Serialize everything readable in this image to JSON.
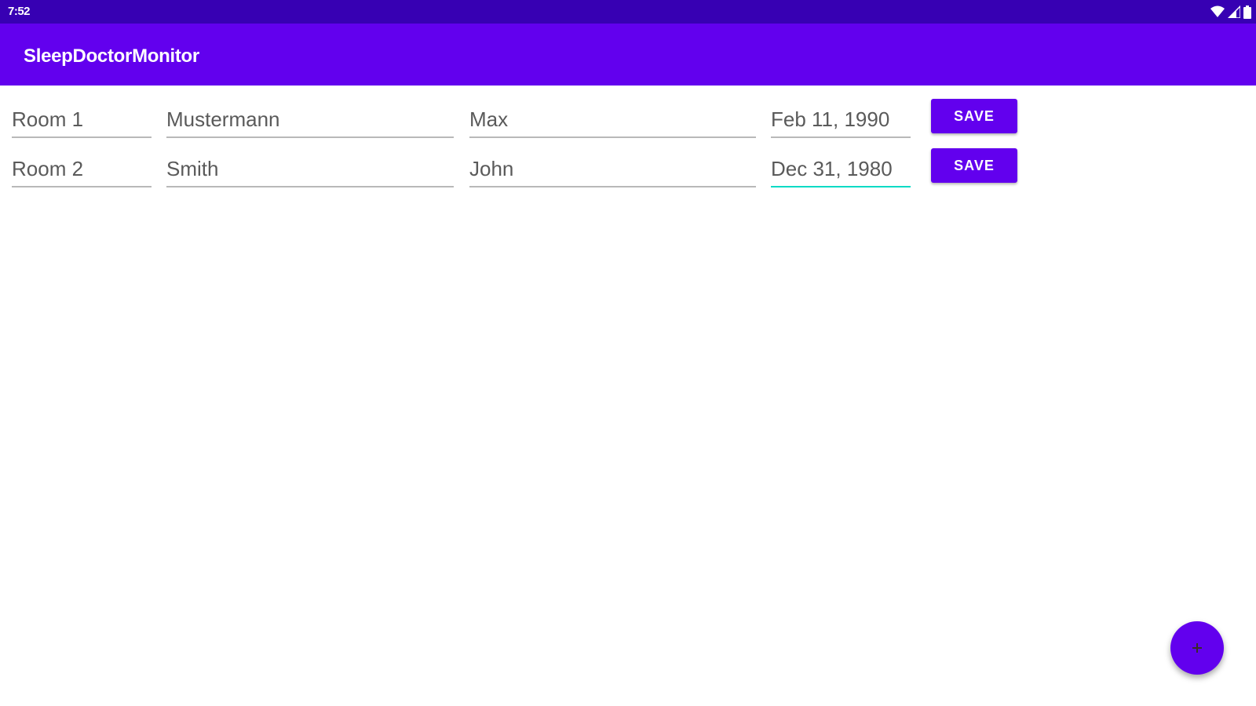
{
  "status_bar": {
    "time": "7:52",
    "icons": [
      "wifi-icon",
      "signal-icon",
      "battery-icon"
    ]
  },
  "app_bar": {
    "title": "SleepDoctorMonitor"
  },
  "rows": [
    {
      "room": "Room 1",
      "last_name": "Mustermann",
      "first_name": "Max",
      "birth_date": "Feb 11, 1990",
      "save_label": "SAVE"
    },
    {
      "room": "Room 2",
      "last_name": "Smith",
      "first_name": "John",
      "birth_date": "Dec 31, 1980",
      "save_label": "SAVE"
    }
  ],
  "fab": {
    "icon": "plus-icon"
  },
  "colors": {
    "status_bar": "#3700b3",
    "primary": "#6200ee",
    "accent": "#03dac5"
  }
}
